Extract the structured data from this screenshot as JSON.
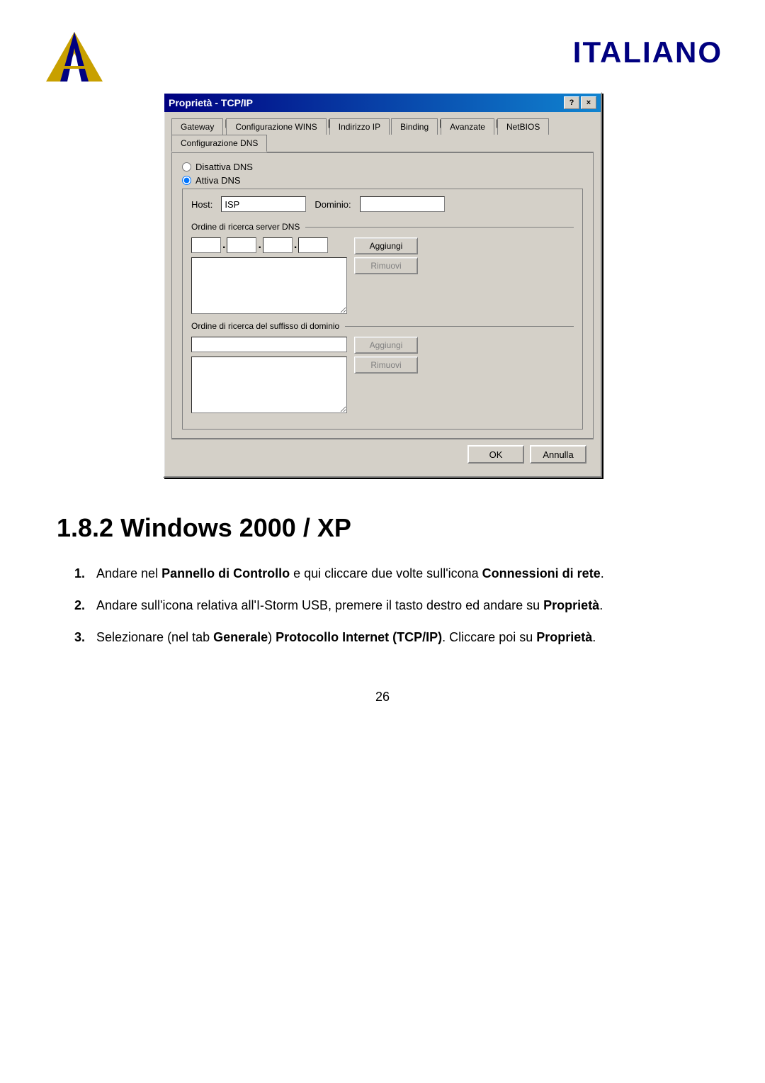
{
  "brand": {
    "italiano_label": "ITALIANO"
  },
  "dialog": {
    "title": "Proprietà - TCP/IP",
    "help_btn": "?",
    "close_btn": "×",
    "tabs": [
      {
        "label": "Gateway",
        "active": false
      },
      {
        "label": "Configurazione WINS",
        "active": false
      },
      {
        "label": "Indirizzo IP",
        "active": false
      },
      {
        "label": "Binding",
        "active": false
      },
      {
        "label": "Avanzate",
        "active": false
      },
      {
        "label": "NetBIOS",
        "active": false
      },
      {
        "label": "Configurazione DNS",
        "active": true
      }
    ],
    "dns_panel": {
      "disable_dns_label": "Disattiva DNS",
      "enable_dns_label": "Attiva DNS",
      "host_label": "Host:",
      "host_value": "ISP",
      "domain_label": "Dominio:",
      "domain_value": "",
      "dns_server_section": "Ordine di ricerca server DNS",
      "ip_parts": [
        "",
        "",
        "",
        ""
      ],
      "aggiungi_btn1": "Aggiungi",
      "rimuovi_btn1": "Rimuovi",
      "domain_suffix_section": "Ordine di ricerca del suffisso di dominio",
      "aggiungi_btn2": "Aggiungi",
      "rimuovi_btn2": "Rimuovi"
    },
    "footer": {
      "ok_btn": "OK",
      "cancel_btn": "Annulla"
    }
  },
  "section": {
    "heading": "1.8.2 Windows 2000 / XP",
    "instructions": [
      {
        "number": "1.",
        "text_before": "Andare nel ",
        "bold1": "Pannello di Controllo",
        "text_mid1": " e qui cliccare due volte sull'icona ",
        "bold2": "Connessioni di rete",
        "text_after": "."
      },
      {
        "number": "2.",
        "text_before": "Andare sull'icona relativa all'I-Storm USB, premere il tasto destro ed andare su ",
        "bold1": "Proprietà",
        "text_after": "."
      },
      {
        "number": "3.",
        "text_before": "Selezionare (nel tab ",
        "bold1": "Generale",
        "text_mid1": ")  ",
        "bold2": "Protocollo Internet (TCP/IP)",
        "text_mid2": ". Cliccare poi su ",
        "bold3": "Proprietà",
        "text_after": "."
      }
    ]
  },
  "page_number": "26"
}
